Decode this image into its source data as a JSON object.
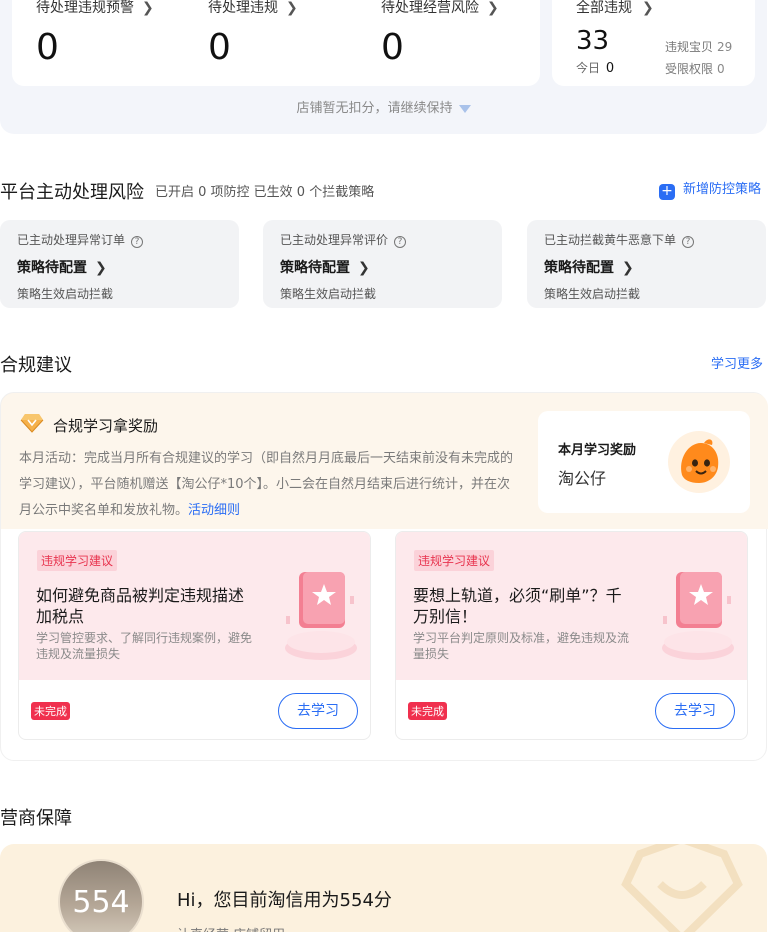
{
  "stats": [
    {
      "label": "待处理违规预警",
      "value": "0"
    },
    {
      "label": "待处理违规",
      "value": "0"
    },
    {
      "label": "待处理经营风险",
      "value": "0"
    }
  ],
  "all_violations": {
    "label": "全部违规",
    "total": "33",
    "today_label": "今日",
    "today_value": "0",
    "item_label": "违规宝贝",
    "item_value": "29",
    "limit_label": "受限权限",
    "limit_value": "0"
  },
  "deduct_note": "店铺暂无扣分，请继续保持",
  "platform_risk": {
    "title": "平台主动处理风险",
    "subtitle": "已开启 0 项防控 已生效 0 个拦截策略",
    "add_label": "新增防控策略",
    "cards": [
      {
        "title": "已主动处理异常订单",
        "status": "策略待配置",
        "footer": "策略生效启动拦截"
      },
      {
        "title": "已主动处理异常评价",
        "status": "策略待配置",
        "footer": "策略生效启动拦截"
      },
      {
        "title": "已主动拦截黄牛恶意下单",
        "status": "策略待配置",
        "footer": "策略生效启动拦截"
      }
    ]
  },
  "compliance": {
    "title": "合规建议",
    "more_label": "学习更多",
    "reward_title": "合规学习拿奖励",
    "desc": "本月活动：完成当月所有合规建议的学习（即自然月月底最后一天结束前没有未完成的学习建议），平台随机赠送【淘公仔*10个】。小二会在自然月结束后进行统计，并在次月公示中奖名单和发放礼物。",
    "desc_link": "活动细则",
    "month_reward_label": "本月学习奖励",
    "month_reward_value": "淘公仔",
    "courses": [
      {
        "tag": "违规学习建议",
        "title": "如何避免商品被判定违规描述加税点",
        "desc": "学习管控要求、了解同行违规案例，避免违规及流量损失",
        "status": "未完成",
        "button": "去学习"
      },
      {
        "tag": "违规学习建议",
        "title": "要想上轨道，必须“刷单”？千万别信！",
        "desc": "学习平台判定原则及标准，避免违规及流量损失",
        "status": "未完成",
        "button": "去学习"
      }
    ]
  },
  "guarantee": {
    "title": "营商保障",
    "score": "554",
    "greeting": "Hi，您目前淘信用为554分",
    "sub": "让真经营·店铺留用"
  },
  "colors": {
    "accent": "#2a6df4",
    "danger": "#f0304e",
    "panel": "#f3f5fa"
  }
}
